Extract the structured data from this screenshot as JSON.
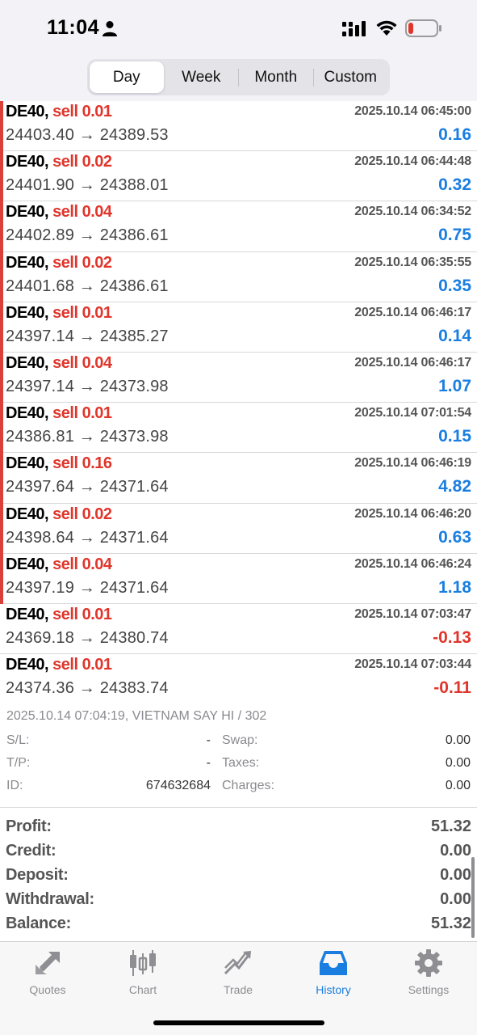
{
  "status": {
    "time": "11:04"
  },
  "periods": [
    "Day",
    "Week",
    "Month",
    "Custom"
  ],
  "active_period": "Day",
  "trades": [
    {
      "symbol": "DE40,",
      "side": "sell 0.01",
      "date": "2025.10.14 06:45:00",
      "prices": "24403.40 → 24389.53",
      "profit": "0.16",
      "sign": "pos"
    },
    {
      "symbol": "DE40,",
      "side": "sell 0.02",
      "date": "2025.10.14 06:44:48",
      "prices": "24401.90 → 24388.01",
      "profit": "0.32",
      "sign": "pos"
    },
    {
      "symbol": "DE40,",
      "side": "sell 0.04",
      "date": "2025.10.14 06:34:52",
      "prices": "24402.89 → 24386.61",
      "profit": "0.75",
      "sign": "pos"
    },
    {
      "symbol": "DE40,",
      "side": "sell 0.02",
      "date": "2025.10.14 06:35:55",
      "prices": "24401.68 → 24386.61",
      "profit": "0.35",
      "sign": "pos"
    },
    {
      "symbol": "DE40,",
      "side": "sell 0.01",
      "date": "2025.10.14 06:46:17",
      "prices": "24397.14 → 24385.27",
      "profit": "0.14",
      "sign": "pos"
    },
    {
      "symbol": "DE40,",
      "side": "sell 0.04",
      "date": "2025.10.14 06:46:17",
      "prices": "24397.14 → 24373.98",
      "profit": "1.07",
      "sign": "pos"
    },
    {
      "symbol": "DE40,",
      "side": "sell 0.01",
      "date": "2025.10.14 07:01:54",
      "prices": "24386.81 → 24373.98",
      "profit": "0.15",
      "sign": "pos"
    },
    {
      "symbol": "DE40,",
      "side": "sell 0.16",
      "date": "2025.10.14 06:46:19",
      "prices": "24397.64 → 24371.64",
      "profit": "4.82",
      "sign": "pos"
    },
    {
      "symbol": "DE40,",
      "side": "sell 0.02",
      "date": "2025.10.14 06:46:20",
      "prices": "24398.64 → 24371.64",
      "profit": "0.63",
      "sign": "pos"
    },
    {
      "symbol": "DE40,",
      "side": "sell 0.04",
      "date": "2025.10.14 06:46:24",
      "prices": "24397.19 → 24371.64",
      "profit": "1.18",
      "sign": "pos"
    },
    {
      "symbol": "DE40,",
      "side": "sell 0.01",
      "date": "2025.10.14 07:03:47",
      "prices": "24369.18 → 24380.74",
      "profit": "-0.13",
      "sign": "neg"
    },
    {
      "symbol": "DE40,",
      "side": "sell 0.01",
      "date": "2025.10.14 07:03:44",
      "prices": "24374.36 → 24383.74",
      "profit": "-0.11",
      "sign": "neg"
    }
  ],
  "details": {
    "header": "2025.10.14 07:04:19, VIETNAM SAY HI / 302",
    "sl_label": "S/L:",
    "sl_value": "-",
    "tp_label": "T/P:",
    "tp_value": "-",
    "id_label": "ID:",
    "id_value": "674632684",
    "swap_label": "Swap:",
    "swap_value": "0.00",
    "taxes_label": "Taxes:",
    "taxes_value": "0.00",
    "charges_label": "Charges:",
    "charges_value": "0.00"
  },
  "summary": [
    {
      "label": "Profit:",
      "value": "51.32"
    },
    {
      "label": "Credit:",
      "value": "0.00"
    },
    {
      "label": "Deposit:",
      "value": "0.00"
    },
    {
      "label": "Withdrawal:",
      "value": "0.00"
    },
    {
      "label": "Balance:",
      "value": "51.32"
    }
  ],
  "tabs": [
    {
      "label": "Quotes",
      "icon": "quotes-icon"
    },
    {
      "label": "Chart",
      "icon": "chart-icon"
    },
    {
      "label": "Trade",
      "icon": "trade-icon"
    },
    {
      "label": "History",
      "icon": "history-icon"
    },
    {
      "label": "Settings",
      "icon": "settings-icon"
    }
  ],
  "active_tab": "History",
  "colors": {
    "accent": "#1a7ee0",
    "sell": "#e0352b",
    "loss": "#e0352b",
    "profit": "#1a7ee0"
  }
}
